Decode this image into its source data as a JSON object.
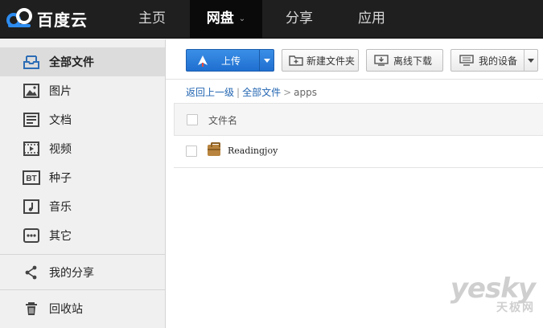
{
  "logo": {
    "text": "百度云"
  },
  "nav": {
    "items": [
      {
        "label": "主页"
      },
      {
        "label": "网盘"
      },
      {
        "label": "分享"
      },
      {
        "label": "应用"
      }
    ]
  },
  "sidebar": {
    "items": [
      {
        "label": "全部文件",
        "icon": "all-files-icon"
      },
      {
        "label": "图片",
        "icon": "image-icon"
      },
      {
        "label": "文档",
        "icon": "document-icon"
      },
      {
        "label": "视频",
        "icon": "video-icon"
      },
      {
        "label": "种子",
        "icon": "bt-icon"
      },
      {
        "label": "音乐",
        "icon": "music-icon"
      },
      {
        "label": "其它",
        "icon": "other-icon"
      },
      {
        "label": "我的分享",
        "icon": "share-icon"
      },
      {
        "label": "回收站",
        "icon": "trash-icon"
      }
    ]
  },
  "toolbar": {
    "upload_label": "上传",
    "new_folder_label": "新建文件夹",
    "offline_download_label": "离线下载",
    "my_devices_label": "我的设备"
  },
  "breadcrumb": {
    "back": "返回上一级",
    "divider": "|",
    "root": "全部文件",
    "arrow": ">",
    "current": "apps"
  },
  "table": {
    "header_name": "文件名",
    "rows": [
      {
        "name": "Readingjoy",
        "type": "folder"
      }
    ]
  },
  "watermark": {
    "main": "yesky",
    "sub": "天极网"
  },
  "colors": {
    "topbar": "#1f1f1f",
    "accent": "#1f6fd0",
    "link": "#2265b1",
    "sidebar": "#f0f0f0"
  }
}
